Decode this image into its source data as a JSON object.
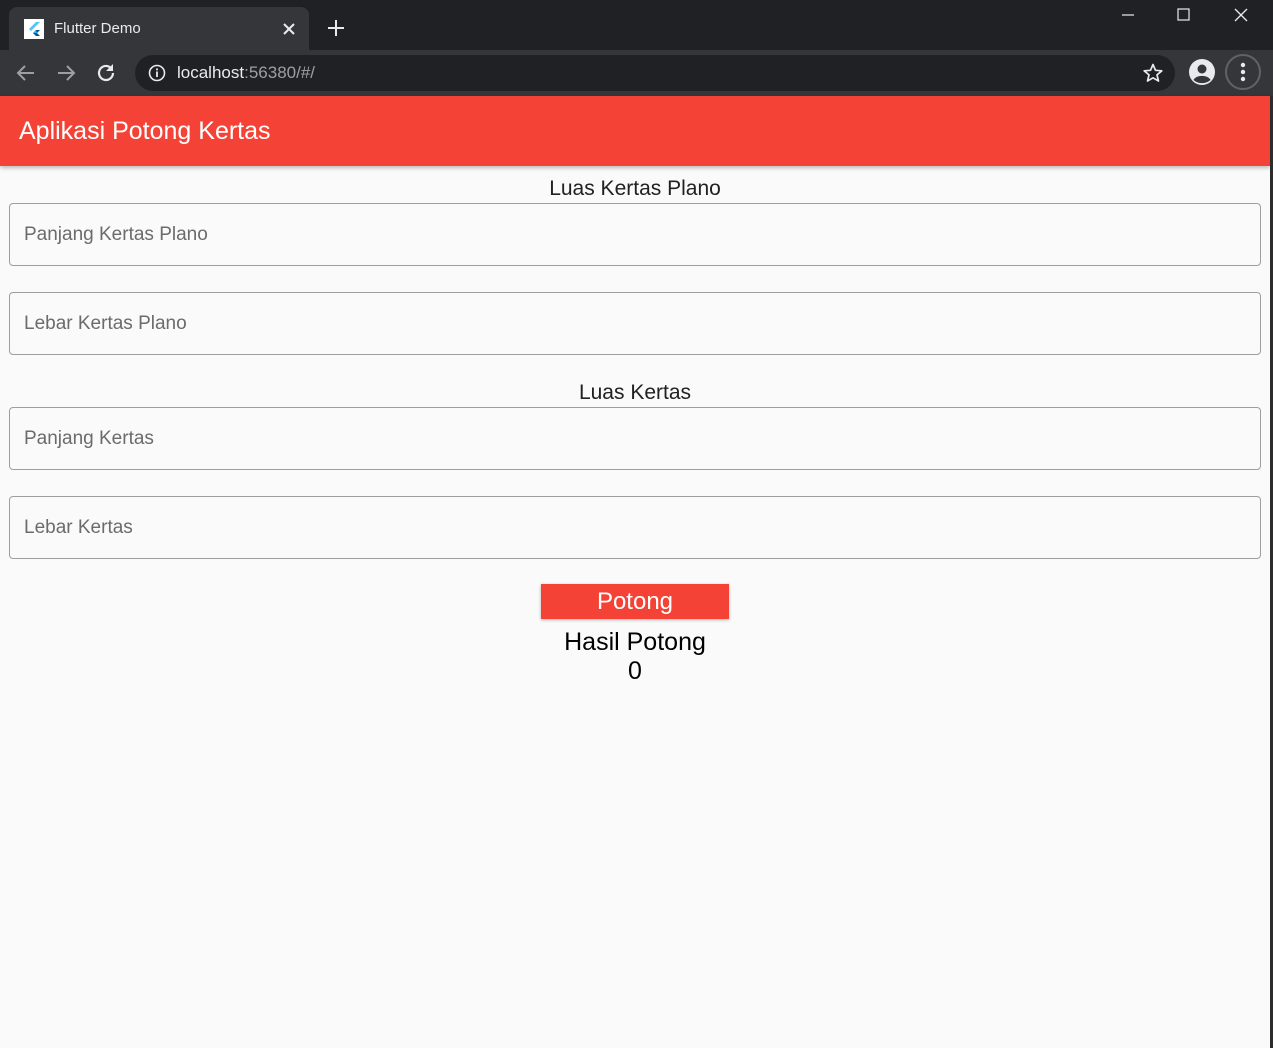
{
  "browser": {
    "tab_title": "Flutter Demo",
    "url_host": "localhost",
    "url_rest": ":56380/#/",
    "icons": {
      "favicon": "flutter-logo-icon",
      "tab_close": "close-icon",
      "new_tab": "plus-icon",
      "back": "arrow-left-icon",
      "forward": "arrow-right-icon",
      "reload": "reload-icon",
      "site_info": "info-icon",
      "bookmark": "star-icon",
      "profile": "account-circle-icon",
      "menu": "more-vert-icon"
    }
  },
  "app": {
    "title": "Aplikasi Potong Kertas",
    "accent_color": "#f44336",
    "plano_section": {
      "label": "Luas Kertas Plano",
      "length_placeholder": "Panjang Kertas Plano",
      "width_placeholder": "Lebar Kertas Plano"
    },
    "paper_section": {
      "label": "Luas Kertas",
      "length_placeholder": "Panjang Kertas",
      "width_placeholder": "Lebar Kertas"
    },
    "cut_button_label": "Potong",
    "result_label": "Hasil Potong",
    "result_value": "0"
  }
}
